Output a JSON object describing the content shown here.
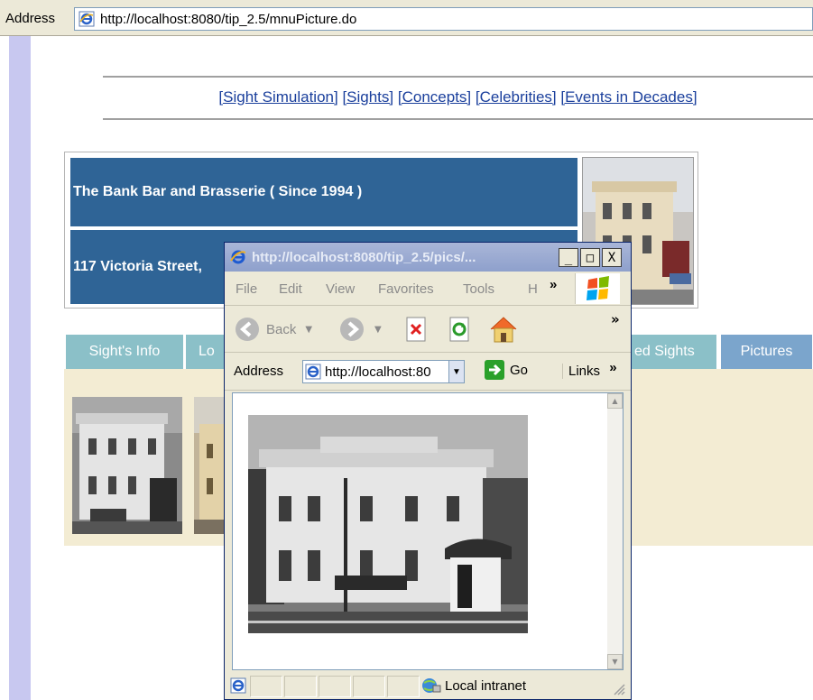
{
  "outer_browser": {
    "address_label": "Address",
    "url": "http://localhost:8080/tip_2.5/mnuPicture.do"
  },
  "nav": {
    "links": [
      "[Sight Simulation]",
      "[Sights]",
      "[Concepts]",
      "[Celebrities]",
      "[Events in Decades]"
    ]
  },
  "header": {
    "name": "The Bank Bar and Brasserie ( Since 1994 )",
    "address": "117 Victoria Street,"
  },
  "tabs": [
    "Sight's Info",
    "Lo",
    "ed Sights",
    "Pictures"
  ],
  "popup": {
    "title": "http://localhost:8080/tip_2.5/pics/...",
    "window_buttons": {
      "minimize": "_",
      "maximize": "□",
      "close": "X"
    },
    "menu": [
      "File",
      "Edit",
      "View",
      "Favorites",
      "Tools",
      "H"
    ],
    "menu_more": "»",
    "toolbar": {
      "back": "Back",
      "more": "»"
    },
    "address_label": "Address",
    "url": "http://localhost:80",
    "go_label": "Go",
    "links_label": "Links",
    "links_more": "»",
    "status_zone": "Local intranet"
  },
  "colors": {
    "header_blue": "#2f6496",
    "tab_teal": "#8bc0c8",
    "tab_active": "#7ba5cc",
    "panel_cream": "#f3ecd3",
    "left_strip": "#c8c8f0",
    "link_blue": "#1a3f9c"
  }
}
